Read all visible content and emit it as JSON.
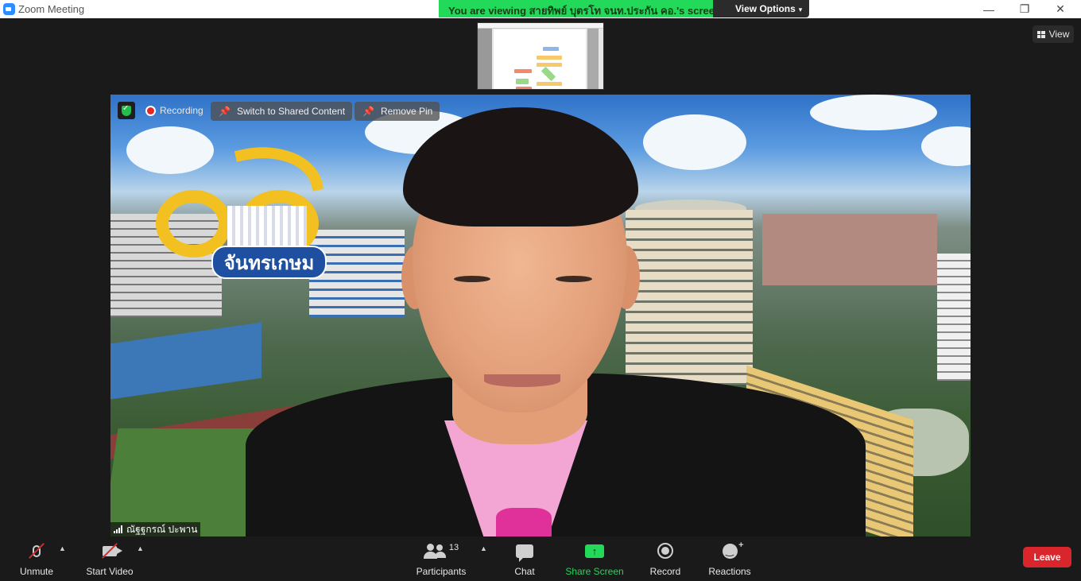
{
  "window": {
    "title": "Zoom Meeting",
    "controls": {
      "minimize": "—",
      "restore": "❐",
      "close": "✕"
    }
  },
  "share_banner": {
    "text": "You are viewing สายทิพย์ บุตรโท จนท.ประกัน คอ.'s screen",
    "view_options": "View Options",
    "colors": {
      "banner": "#23d959",
      "options": "#2b2b2b"
    }
  },
  "view_button": {
    "label": "View"
  },
  "video": {
    "recording_label": "Recording",
    "switch_label": "Switch to Shared Content",
    "remove_pin_label": "Remove Pin",
    "participant_name": "ณัฐฐกรณ์ ปะพาน",
    "logo_text": "จันทรเกษม"
  },
  "toolbar": {
    "unmute": "Unmute",
    "start_video": "Start Video",
    "participants": "Participants",
    "participant_count": "13",
    "chat": "Chat",
    "share_screen": "Share Screen",
    "record": "Record",
    "reactions": "Reactions",
    "leave": "Leave",
    "colors": {
      "accent": "#23d959",
      "leave": "#d8262c",
      "muted": "#e02828"
    }
  },
  "icons": [
    "app-icon",
    "shield-icon",
    "record-dot-icon",
    "pin-icon",
    "signal-icon",
    "mic-muted-icon",
    "video-off-icon",
    "participants-icon",
    "chat-icon",
    "share-screen-icon",
    "record-icon",
    "reactions-icon",
    "grid-view-icon",
    "chevron-down-icon",
    "caret-up-icon"
  ]
}
